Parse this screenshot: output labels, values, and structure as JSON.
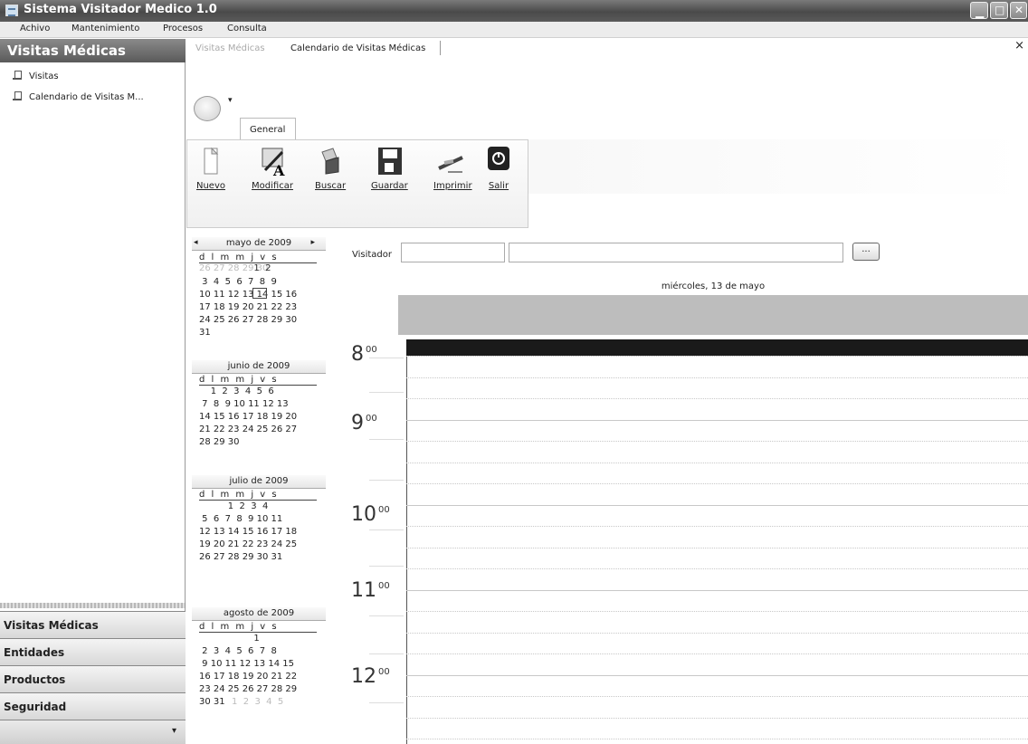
{
  "window": {
    "title": "Sistema Visitador Medico 1.0"
  },
  "menu": [
    "Achivo",
    "Mantenimiento",
    "Procesos",
    "Consulta"
  ],
  "sidebar": {
    "header": "Visitas Médicas",
    "items": [
      "Visitas",
      "Calendario de Visitas M..."
    ],
    "sections": [
      "Visitas Médicas",
      "Entidades",
      "Productos",
      "Seguridad"
    ]
  },
  "tabs": {
    "inactive": "Visitas Médicas",
    "active": "Calendario de Visitas Médicas",
    "close": "×"
  },
  "ribbon": {
    "tab": "General",
    "buttons": [
      "Nuevo",
      "Modificar",
      "Buscar",
      "Guardar",
      "Imprimir",
      "Salir"
    ]
  },
  "visitador": {
    "label": "Visitador",
    "button": "..."
  },
  "day_view": {
    "date": "miércoles, 13 de mayo",
    "hours": [
      "8",
      "9",
      "10",
      "11",
      "12"
    ],
    "minutes": "00"
  },
  "calendars": [
    {
      "title": "mayo de 2009",
      "dow": "d l m m j v s",
      "weeks": [
        "                   1  2",
        " 3  4  5  6  7  8  9",
        "10 11 12 13 14 15 16",
        "17 18 19 20 21 22 23",
        "24 25 26 27 28 29 30",
        "31"
      ],
      "prev_gray": "26 27 28 29 30"
    },
    {
      "title": "junio de 2009",
      "dow": "d l m m j v s",
      "weeks": [
        "    1  2  3  4  5  6",
        " 7  8  9 10 11 12 13",
        "14 15 16 17 18 19 20",
        "21 22 23 24 25 26 27",
        "28 29 30"
      ]
    },
    {
      "title": "julio de 2009",
      "dow": "d l m m j v s",
      "weeks": [
        "          1  2  3  4",
        " 5  6  7  8  9 10 11",
        "12 13 14 15 16 17 18",
        "19 20 21 22 23 24 25",
        "26 27 28 29 30 31"
      ]
    },
    {
      "title": "agosto de 2009",
      "dow": "d l m m j v s",
      "weeks": [
        "                   1",
        " 2  3  4  5  6  7  8",
        " 9 10 11 12 13 14 15",
        "16 17 18 19 20 21 22",
        "23 24 25 26 27 28 29",
        "30 31"
      ],
      "next_gray": "1  2  3  4  5"
    }
  ],
  "today": "13"
}
